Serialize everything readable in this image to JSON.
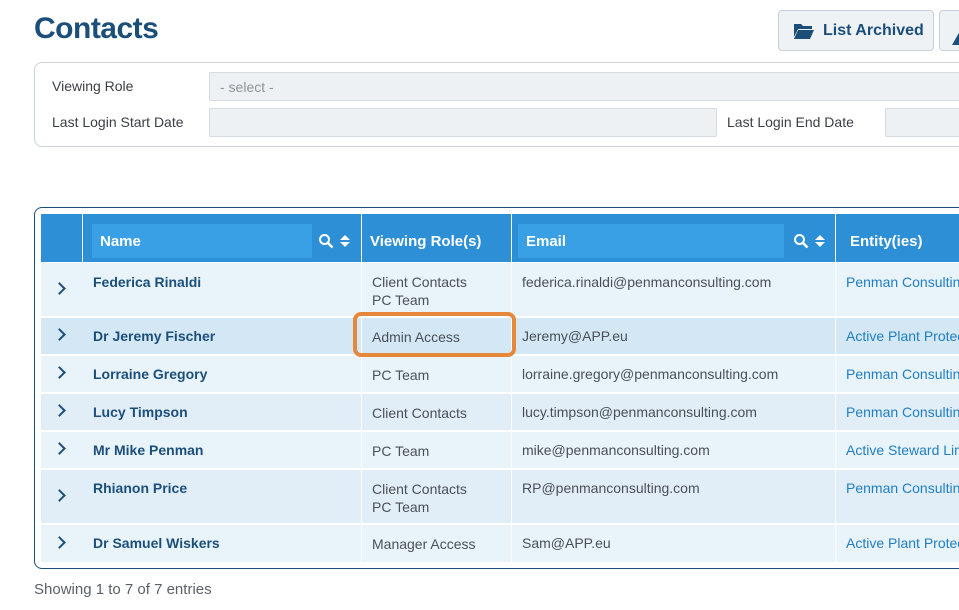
{
  "page": {
    "title": "Contacts"
  },
  "toolbar": {
    "list_archived_label": "List Archived"
  },
  "filters": {
    "viewing_role_label": "Viewing Role",
    "viewing_role_value": "- select -",
    "last_login_start_label": "Last Login Start Date",
    "last_login_start_value": "",
    "last_login_end_label": "Last Login End Date",
    "last_login_end_value": ""
  },
  "table": {
    "columns": [
      "Name",
      "Viewing Role(s)",
      "Email",
      "Entity(ies)"
    ],
    "rows": [
      {
        "name": "Federica Rinaldi",
        "roles": [
          "Client Contacts",
          "PC Team"
        ],
        "email": "federica.rinaldi@penmanconsulting.com",
        "entity": "Penman Consultin"
      },
      {
        "name": "Dr Jeremy Fischer",
        "roles": [
          "Admin Access"
        ],
        "email": "Jeremy@APP.eu",
        "entity": "Active Plant Protec"
      },
      {
        "name": "Lorraine Gregory",
        "roles": [
          "PC Team"
        ],
        "email": "lorraine.gregory@penmanconsulting.com",
        "entity": "Penman Consultin"
      },
      {
        "name": "Lucy Timpson",
        "roles": [
          "Client Contacts"
        ],
        "email": "lucy.timpson@penmanconsulting.com",
        "entity": "Penman Consultin"
      },
      {
        "name": "Mr Mike Penman",
        "roles": [
          "PC Team"
        ],
        "email": "mike@penmanconsulting.com",
        "entity": "Active Steward Lim"
      },
      {
        "name": "Rhianon Price",
        "roles": [
          "Client Contacts",
          "PC Team"
        ],
        "email": "RP@penmanconsulting.com",
        "entity": "Penman Consultin"
      },
      {
        "name": "Dr Samuel Wiskers",
        "roles": [
          "Manager Access"
        ],
        "email": "Sam@APP.eu",
        "entity": "Active Plant Protec"
      }
    ]
  },
  "footer": {
    "info": "Showing 1 to 7 of 7 entries"
  },
  "colors": {
    "brand": "#1b4f7a",
    "header": "#2d8fd5",
    "highlight": "#e6883a",
    "link": "#1f7fc4"
  }
}
